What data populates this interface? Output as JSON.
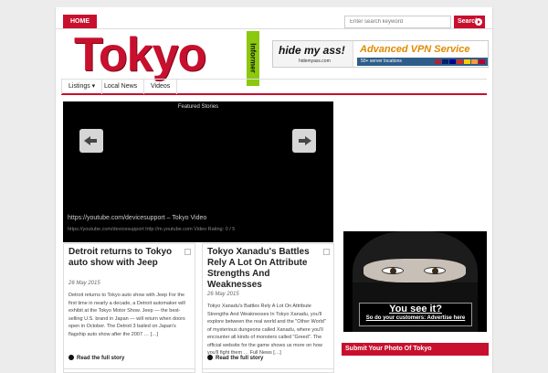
{
  "topbar": {
    "home_label": "HOME",
    "search_placeholder": "Enter search keyword",
    "search_button": "Search"
  },
  "header": {
    "logo": "Tokyo",
    "logo_tag": "Informer"
  },
  "ad_banner": {
    "brand": "hide my ass!",
    "brand_sub": "hidemyass.com",
    "title": "Advanced VPN Service",
    "strip": "50+ server locations"
  },
  "nav": {
    "items": [
      {
        "label": "Listings ▾"
      },
      {
        "label": "Local News"
      },
      {
        "label": "Videos"
      }
    ]
  },
  "slider": {
    "title": "Featured Stories",
    "caption": "https://youtube.com/devicesupport – Tokyo Video",
    "meta": "https://youtube.com/devicesupport http://m.youtube.com Video Rating: 0 / 5"
  },
  "posts": [
    {
      "title": "Detroit returns to Tokyo auto show with Jeep",
      "date": "26 May 2015",
      "excerpt": "Detroit returns to Tokyo auto show with Jeep For the first time in nearly a decade, a Detroit automaker will exhibit at the Tokyo Motor Show. Jeep — the best-selling U.S. brand in Japan — will return when doors open in October. The Detroit 3 bailed on Japan's flagship auto show after the 2007 … […]",
      "read_more": "Read the full story"
    },
    {
      "title": "Tokyo Xanadu's Battles Rely A Lot On Attribute Strengths And Weaknesses",
      "date": "26 May 2015",
      "excerpt": "Tokyo Xanadu's Battles Rely A Lot On Attribute Strengths And Weaknesses In Tokyo Xanadu, you'll explore between the real world and the \"Other World\" of mysterious dungeons called Xanadu, where you'll encounter all kinds of monsters called \"Greed\". The official website for the game shows us more on how you'll fight them … Full News […]",
      "read_more": "Read the full story"
    }
  ],
  "sidebar": {
    "ad_title": "You see it?",
    "ad_sub": "So do your customers: Advertise here",
    "submit_label": "Submit Your Photo Of Tokyo"
  },
  "colors": {
    "accent": "#c8102e",
    "informer": "#8bc80e",
    "vpn_orange": "#e08a00"
  }
}
